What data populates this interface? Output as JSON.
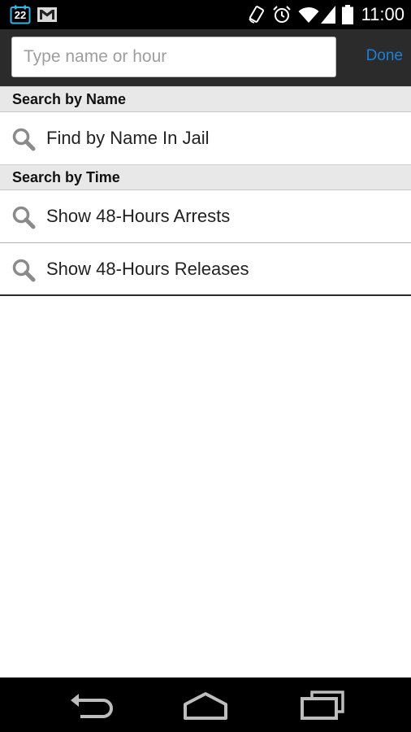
{
  "status_bar": {
    "calendar_day": "22",
    "time": "11:00",
    "icons": [
      "calendar-icon",
      "gmail-icon",
      "rotate-icon",
      "alarm-icon",
      "wifi-icon",
      "signal-icon",
      "battery-icon"
    ]
  },
  "search": {
    "placeholder": "Type name or hour",
    "value": "",
    "done_label": "Done"
  },
  "sections": {
    "by_name": {
      "header": "Search by Name",
      "items": [
        {
          "label": "Find by Name In Jail",
          "icon": "search-icon"
        }
      ]
    },
    "by_time": {
      "header": "Search by Time",
      "items": [
        {
          "label": "Show 48-Hours Arrests",
          "icon": "search-icon"
        },
        {
          "label": "Show 48-Hours Releases",
          "icon": "search-icon"
        }
      ]
    }
  },
  "nav_bar": {
    "icons": [
      "back-icon",
      "home-icon",
      "recent-apps-icon"
    ]
  },
  "colors": {
    "accent": "#1f7fd6",
    "header_bg": "#2b2b2b",
    "section_bg": "#e8e8e8",
    "icon_gray": "#8a8a8a"
  }
}
